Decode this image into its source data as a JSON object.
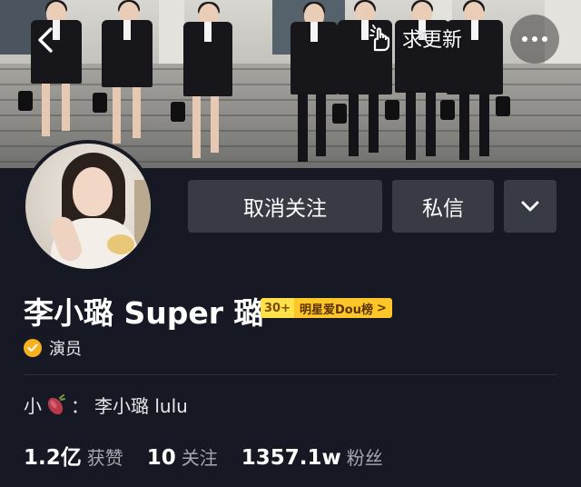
{
  "header": {
    "back_icon": "chevron-left-icon",
    "update_request_label": "求更新",
    "update_request_icon": "hand-pointer-icon",
    "more_icon": "more-dots-icon"
  },
  "profile": {
    "display_name": "李小璐 Super 璐",
    "rank_badge": {
      "rank": "30+",
      "label": "明星爱Dou榜",
      "arrow": ">",
      "colors": {
        "rank_bg": "#ffe24a",
        "label_bg": "#ffc629"
      }
    },
    "verification": {
      "icon": "verified-check-icon",
      "label": "演员",
      "color": "#f5b21e"
    },
    "alias_prefix": "小",
    "alias_emoji": "sweet-potato-icon",
    "alias_separator": "：",
    "alias_value": "李小璐 lulu"
  },
  "actions": {
    "unfollow_label": "取消关注",
    "message_label": "私信",
    "dropdown_icon": "chevron-down-icon"
  },
  "stats": [
    {
      "value": "1.2亿",
      "label": "获赞"
    },
    {
      "value": "10",
      "label": "关注"
    },
    {
      "value": "1357.1w",
      "label": "粉丝"
    }
  ],
  "colors": {
    "background": "#161823",
    "button": "#393b44",
    "muted_text": "#a6a7ad"
  }
}
